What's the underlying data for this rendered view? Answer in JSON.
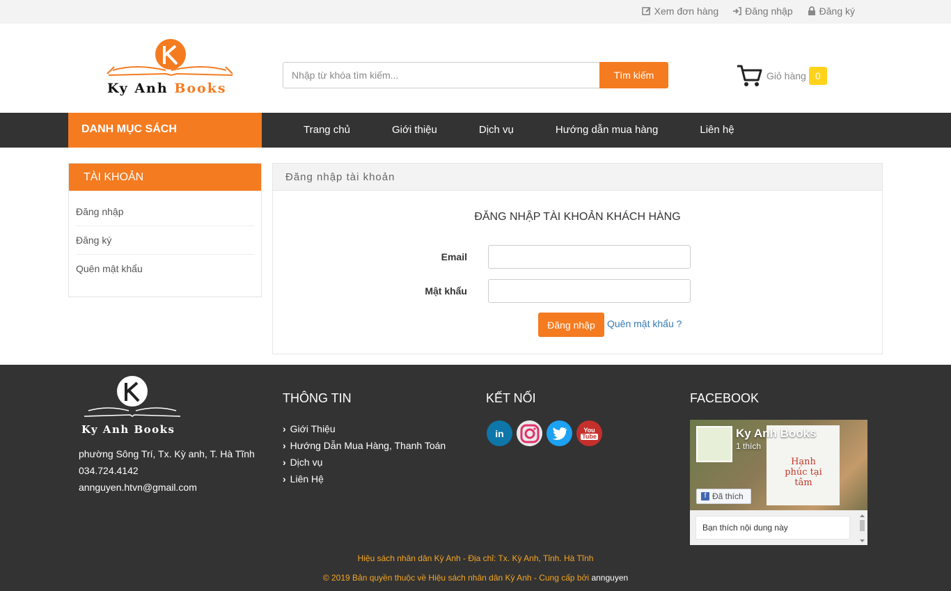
{
  "topbar": {
    "orders": "Xem đơn hàng",
    "login": "Đăng nhập",
    "register": "Đăng ký"
  },
  "header": {
    "logo_text_1": "Ky Anh ",
    "logo_text_2": "Books",
    "search_placeholder": "Nhập từ khóa tìm kiếm...",
    "search_button": "Tìm kiếm",
    "cart_label": "Giỏ hàng",
    "cart_count": "0"
  },
  "navbar": {
    "category_title": "DANH MỤC SÁCH",
    "items": [
      "Trang chủ",
      "Giới thiệu",
      "Dịch vụ",
      "Hướng dẫn mua hàng",
      "Liên hệ"
    ]
  },
  "sidebar": {
    "title": "TÀI KHOẢN",
    "items": [
      "Đăng nhập",
      "Đăng ký",
      "Quên mật khẩu"
    ]
  },
  "login_panel": {
    "heading": "Đăng nhập tài khoản",
    "subtitle": "ĐĂNG NHẬP TÀI KHOẢN KHÁCH HÀNG",
    "email_label": "Email",
    "password_label": "Mật khẩu",
    "submit": "Đăng nhập",
    "forgot": "Quên mật khẩu ?"
  },
  "footer": {
    "logo_text": "Ky Anh Books",
    "address": "phường Sông Trí, Tx. Kỳ anh, T. Hà Tĩnh",
    "phone": "034.724.4142",
    "email": "annguyen.htvn@gmail.com",
    "info_title": "THÔNG TIN",
    "info_links": [
      "Giới Thiệu",
      "Hướng Dẫn Mua Hàng, Thanh Toán",
      "Dịch vụ",
      "Liên Hệ"
    ],
    "connect_title": "KẾT NỐI",
    "social": [
      "linkedin-icon",
      "instagram-icon",
      "twitter-icon",
      "youtube-icon"
    ],
    "facebook_title": "FACEBOOK",
    "fb_page_name": "Ky Anh Books",
    "fb_likes": "1 thích",
    "fb_liked": "Đã thích",
    "fb_book_title": "Hạnh phúc tại tâm",
    "fb_post": "Bạn thích nội dung này",
    "bottom_line1": "Hiệu sách nhân dân Kỳ Anh - Địa chỉ: Tx. Kỳ Anh, Tỉnh. Hà Tĩnh",
    "bottom_line2_prefix": "© 2019 Bản quyền thuộc về Hiệu sách nhân dân Kỳ Anh - Cung cấp bởi ",
    "bottom_line2_author": "annguyen"
  },
  "colors": {
    "accent": "#f47b20",
    "dark": "#333333",
    "cart_badge": "#ffd31a",
    "link": "#337ab7"
  }
}
